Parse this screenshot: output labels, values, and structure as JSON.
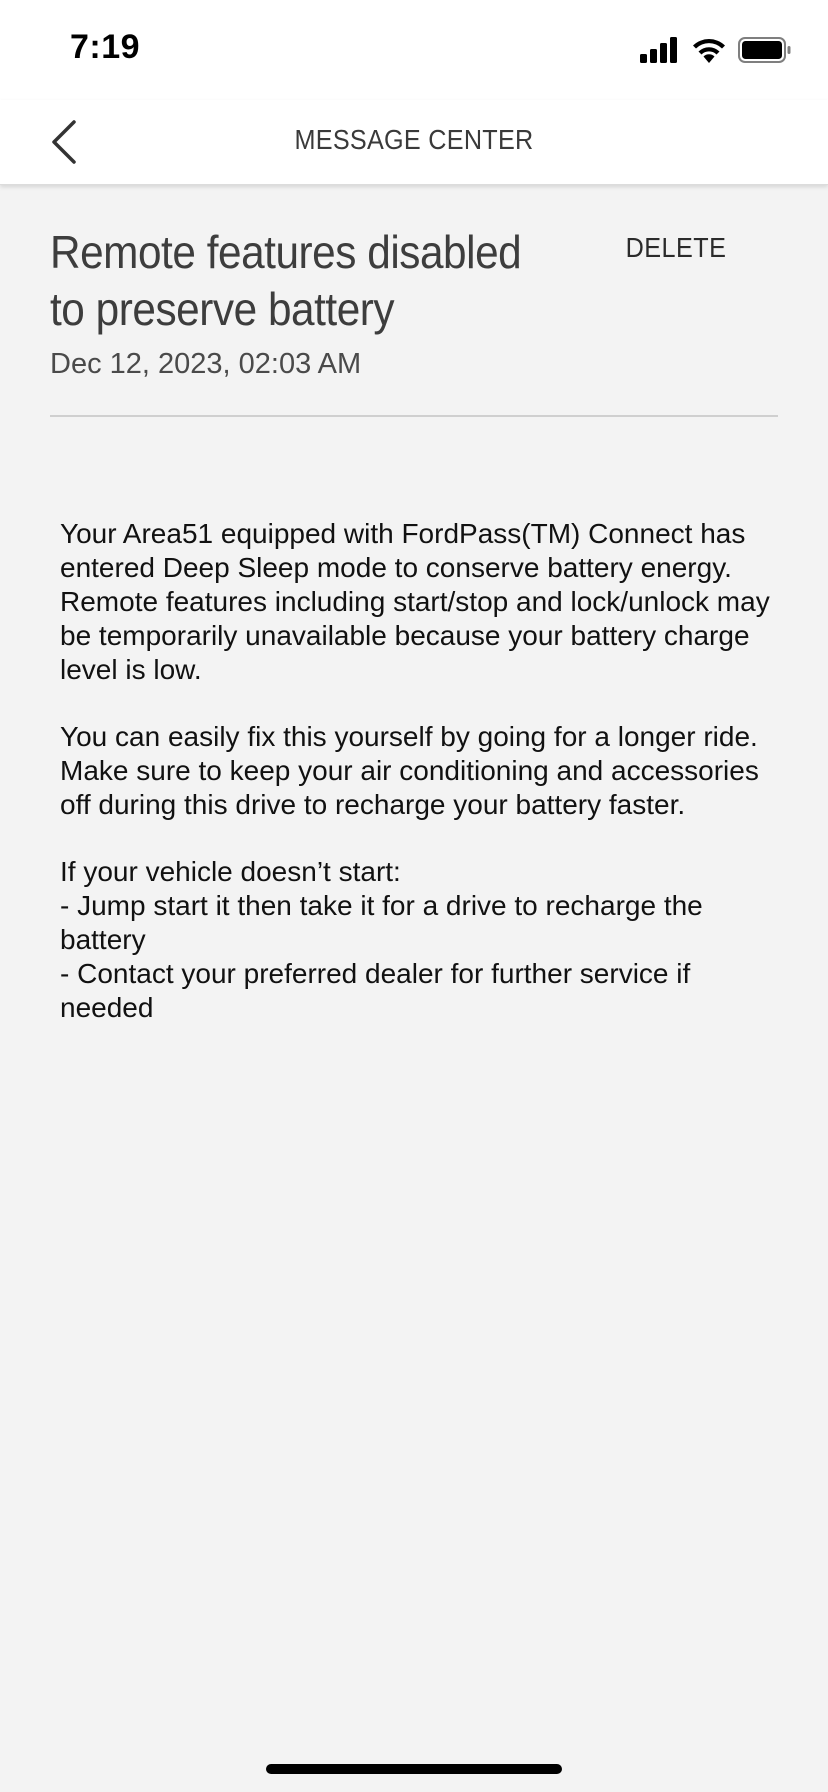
{
  "status_bar": {
    "time": "7:19",
    "icons": [
      "signal-icon",
      "wifi-icon",
      "battery-icon"
    ]
  },
  "nav": {
    "title": "MESSAGE CENTER",
    "back_icon": "chevron-left-icon"
  },
  "message": {
    "title": "Remote features disabled to preserve battery",
    "date": "Dec 12, 2023, 02:03 AM",
    "delete_label": "DELETE",
    "paragraphs": [
      "Your Area51 equipped with FordPass(TM) Connect has entered Deep Sleep mode to conserve battery energy. Remote features including start/stop and lock/unlock may be temporarily unavailable because your battery charge level is low.",
      "You can easily fix this yourself by going for a longer ride. Make sure to keep your air conditioning and accessories off during this drive to recharge your battery faster."
    ],
    "no_start_heading": "If your vehicle doesn’t start:",
    "no_start_steps": [
      "- Jump start it then take it for a drive to recharge the battery",
      "- Contact your preferred dealer for further service if needed"
    ]
  },
  "colors": {
    "background": "#f3f3f3",
    "bar_background": "#ffffff",
    "text_primary": "#111111",
    "text_title": "#3d3d3d",
    "divider": "#cfcfcf"
  }
}
